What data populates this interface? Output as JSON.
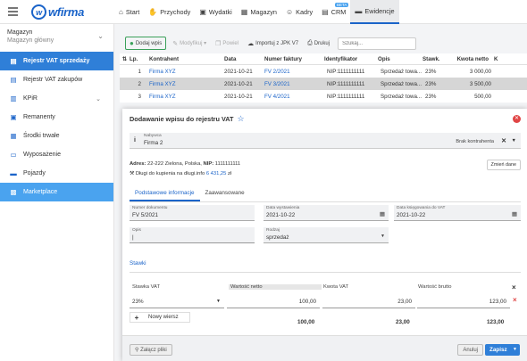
{
  "brand": "wfirma",
  "nav": [
    {
      "label": "Start",
      "icon": "home-icon",
      "glyph": "⌂"
    },
    {
      "label": "Przychody",
      "icon": "hand-coin-icon",
      "glyph": "✋"
    },
    {
      "label": "Wydatki",
      "icon": "wallet-icon",
      "glyph": "▣"
    },
    {
      "label": "Magazyn",
      "icon": "warehouse-icon",
      "glyph": "▦"
    },
    {
      "label": "Kadry",
      "icon": "people-icon",
      "glyph": "☺"
    },
    {
      "label": "CRM",
      "icon": "crm-icon",
      "glyph": "▤",
      "badge": "BETA"
    },
    {
      "label": "Ewidencje",
      "icon": "folder-icon",
      "glyph": "▬"
    }
  ],
  "sidebar": {
    "magazyn_title": "Magazyn",
    "magazyn_sub": "Magazyn główny",
    "items": [
      {
        "label": "Rejestr VAT sprzedaży",
        "icon": "doc-icon",
        "glyph": "▤"
      },
      {
        "label": "Rejestr VAT zakupów",
        "icon": "doc-icon",
        "glyph": "▤"
      },
      {
        "label": "KPiR",
        "icon": "book-icon",
        "glyph": "▥"
      },
      {
        "label": "Remanenty",
        "icon": "inventory-icon",
        "glyph": "▣"
      },
      {
        "label": "Środki trwałe",
        "icon": "asset-icon",
        "glyph": "▦"
      },
      {
        "label": "Wyposażenie",
        "icon": "laptop-icon",
        "glyph": "▭"
      },
      {
        "label": "Pojazdy",
        "icon": "car-icon",
        "glyph": "▬"
      },
      {
        "label": "Marketplace",
        "icon": "cart-icon",
        "glyph": "▩"
      }
    ]
  },
  "toolbar": {
    "add": "Dodaj wpis",
    "edit": "Modyfikuj",
    "duplicate": "Powiel",
    "import": "Importuj z JPK V7",
    "print": "Drukuj",
    "search_placeholder": "Szukaj..."
  },
  "table": {
    "headers": [
      "Lp.",
      "Kontrahent",
      "Data",
      "Numer faktury",
      "Identyfikator",
      "Opis",
      "Stawk...",
      "Kwota netto",
      "K"
    ],
    "rows": [
      [
        "1",
        "Firma XYZ",
        "2021-10-21",
        "FV 2/2021",
        "NIP:1111111111",
        "Sprzedaż towa...",
        "23%",
        "3 000,00"
      ],
      [
        "2",
        "Firma XYZ",
        "2021-10-21",
        "FV 3/2021",
        "NIP:1111111111",
        "Sprzedaż towa...",
        "23%",
        "3 500,00"
      ],
      [
        "3",
        "Firma XYZ",
        "2021-10-21",
        "FV 4/2021",
        "NIP:1111111111",
        "Sprzedaż towa...",
        "23%",
        "500,00"
      ]
    ]
  },
  "modal": {
    "title": "Dodawanie wpisu do rejestru VAT",
    "nabywca_label": "Nabywca",
    "nabywca_value": "Firma 2",
    "brak": "Brak kontrahenta",
    "adres_label": "Adres:",
    "adres_value": "22-222 Zielona, Polska,",
    "nip_label": "NIP:",
    "nip_value": "1111111111",
    "dlug_text": "Długi do kupienia na długi.info",
    "dlug_amount": "6 431,25",
    "dlug_currency": "zł",
    "zmien": "Zmień dane",
    "tabs": [
      "Podstawowe informacje",
      "Zaawansowane"
    ],
    "numer_label": "Numer dokumentu",
    "numer_value": "FV 5/2021",
    "wyst_label": "Data wystawienia",
    "wyst_value": "2021-10-22",
    "ksieg_label": "Data księgowania do VAT",
    "ksieg_value": "2021-10-22",
    "opis_label": "Opis",
    "rodzaj_label": "Rodzaj",
    "rodzaj_value": "sprzedaż",
    "stawki_tab": "Stawki",
    "vat_headers": [
      "Stawka VAT",
      "Wartość netto",
      "Kwota VAT",
      "Wartość brutto"
    ],
    "vat_row": {
      "stawka": "23%",
      "netto": "100,00",
      "vat": "23,00",
      "brutto": "123,00"
    },
    "add_row": "Nowy wiersz",
    "totals": {
      "netto": "100,00",
      "vat": "23,00",
      "brutto": "123,00"
    },
    "attach": "Załącz pliki",
    "cancel": "Anuluj",
    "save": "Zapisz"
  }
}
